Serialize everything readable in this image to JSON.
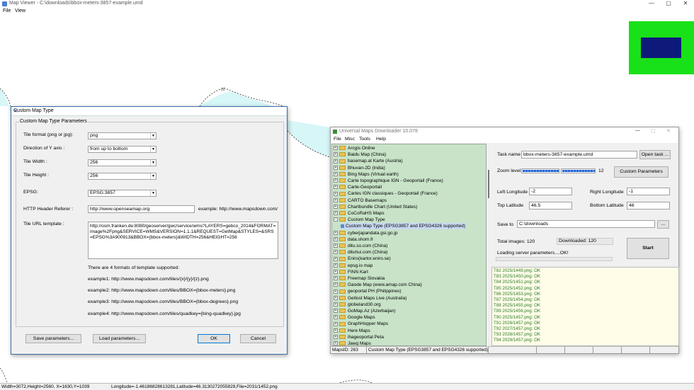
{
  "app": {
    "title": "Map Viewer - C:\\downloads\\bbox-meters-3857-example.umd",
    "menu": [
      "File",
      "View"
    ],
    "window_buttons": [
      "—",
      "▢",
      "✕"
    ],
    "colors": {
      "overview_bg": "#19e119",
      "viewport": "#0e1a7a",
      "water": "#d6f6f8"
    }
  },
  "statusbar": {
    "left": "Width=3072,Height=2560, X=1630,Y=1039",
    "right": "Longitude=-1.46186828613281,Latitude=46.3130272055829,File=2031/1452.png"
  },
  "dialog": {
    "title": "Custom Map Type",
    "close": "✕",
    "group_label": "Custom Map Type Parameters",
    "tile_format": {
      "label": "Tile format (png or jpg):",
      "value": "png"
    },
    "y_axis": {
      "label": "Direction of Y axis :",
      "value": "from up to bottom"
    },
    "tile_width": {
      "label": "Tile Width :",
      "value": "256"
    },
    "tile_height": {
      "label": "Tile Height :",
      "value": "256"
    },
    "epsg": {
      "label": "EPSG:",
      "value": "EPSG:3857"
    },
    "referer": {
      "label": "HTTP Header Referer :",
      "value": "http://www.openseamap.org",
      "example": "example: http://www.mapsdown.com/"
    },
    "url_template": {
      "label": "Tile URL template :",
      "value": "http://osm.franken.de:8080/geoserver/gwc/service/wms?LAYERS=gebco_2014&FORMAT=image%2Fpng&SERVICE=WMS&VERSION=1.1.1&REQUEST=GetMap&STYLES=&SRS=EPSG%3A900913&BBOX={bbox-meters}&WIDTH=256&HEIGHT=256"
    },
    "formats_note": "There are 4 formats of template supported:",
    "examples": [
      "example1: http://www.mapsdown.com/tiles/{x}/{y}/{z}.png",
      "example2: http://www.mapsdown.com/tiles/BBOX={bbox-meters}.png",
      "example3: http://www.mapsdown.com/tiles/BBOX={bbox-degrees}.png",
      "example4: http://www.mapsdown.com/tiles/quadkey={bing-quadkey}.jpg"
    ],
    "save_btn": "Save parameters...",
    "load_btn": "Load parameters...",
    "ok_btn": "OK",
    "cancel_btn": "Cancel"
  },
  "umd": {
    "title": "Universal Maps Downloader 10.078",
    "menu": [
      "File",
      "Misc",
      "Tools",
      "Help"
    ],
    "tree": [
      "Arcgis Online",
      "Baidu Map (China)",
      "basemap.at Karte (Austria)",
      "Bhuvan-2D (India)",
      "Bing Maps (Virtual earth)",
      "Carte topographique IGN - Geoportail (France)",
      "Carte-Geoportail",
      "Cartes IGN classiques - Geoportail (France)",
      "CARTO Basemaps",
      "Chartbundle Chart (United States)",
      "CoCoRaHS Maps",
      "Custom Map Type",
      "Custom Map Type (EPSG3857 and EPSG4326 supported)",
      "cyberjapandata.gsi.go.jp",
      "data.shom.fr",
      "ditu.so.com (China)",
      "dituhui.com (China)",
      "Eniro(kartor.eniro.se)",
      "epsg.io map",
      "FINN Kart",
      "Freemap Slovakia",
      "Gaode Map (www.amap.com China)",
      "geoportal PH (Philippines)",
      "Getlost Maps Live (Australia)",
      "globeland30.org",
      "GoMap.Az (Azerbaijan)",
      "Google Maps",
      "GraphHopper Maps",
      "Here Maps",
      "ihageoportal Peta",
      "Jawg Maps"
    ],
    "task_name": {
      "label": "Task name",
      "value": "bbox-meters-3857-example.umd"
    },
    "open_task": "Open task ...",
    "zoom": {
      "label": "Zoom level",
      "value": "12"
    },
    "custom_params_btn": "Custom Parameters",
    "left_lon": {
      "label": "Left Longitude",
      "value": "-2"
    },
    "right_lon": {
      "label": "Right Longitude",
      "value": "-1"
    },
    "top_lat": {
      "label": "Top Latitude",
      "value": "46.5"
    },
    "bottom_lat": {
      "label": "Bottom Latitude",
      "value": "46"
    },
    "save_to": {
      "label": "Save to",
      "value": "C:\\downloads",
      "browse": "..."
    },
    "total_images": "Total images: 120",
    "downloaded": "Downloaded: 120",
    "loading": "Loading server parameters....OK!",
    "start": "Start",
    "log": [
      "T82 2025/1449.png: OK",
      "T83 2025/1450.png: OK",
      "T84 2025/1451.png: OK",
      "T85 2025/1452.png: OK",
      "T86 2025/1453.png: OK",
      "T87 2025/1454.png: OK",
      "T88 2025/1455.png: OK",
      "T89 2025/1456.png: OK",
      "T90 2025/1457.png: OK",
      "T91 2026/1457.png: OK",
      "T92 2027/1457.png: OK",
      "T93 2028/1457.png: OK",
      "T94 2029/1457.png: OK"
    ],
    "status": {
      "maps_id": "MapsID: 263",
      "selected": "Custom Map Type (EPSG3857 and EPSG4326 supported)"
    }
  }
}
